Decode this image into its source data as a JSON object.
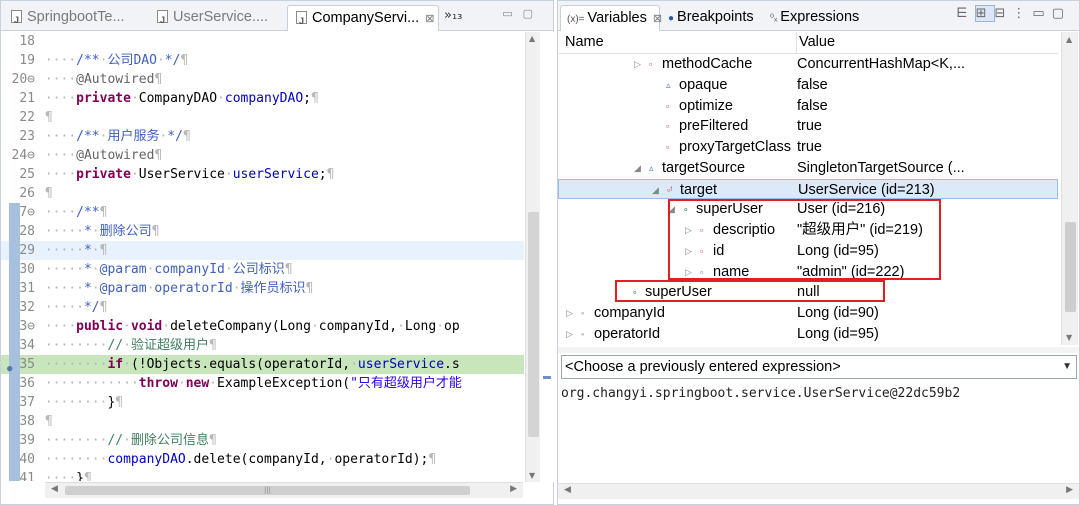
{
  "editor": {
    "tabs": [
      {
        "label": "SpringbootTe...",
        "active": false,
        "closable": false
      },
      {
        "label": "UserService....",
        "active": false,
        "closable": false
      },
      {
        "label": "CompanyServi...",
        "active": true,
        "closable": true
      }
    ],
    "tab_overflow": "»₁₃",
    "code_lines": [
      {
        "num": "18",
        "text": ""
      },
      {
        "num": "19",
        "text": "····/**·公司DAO·*/¶"
      },
      {
        "num": "20⊖",
        "text": "····@Autowired¶"
      },
      {
        "num": "21",
        "text": "····private·CompanyDAO·companyDAO;¶"
      },
      {
        "num": "22",
        "text": "¶"
      },
      {
        "num": "23",
        "text": "····/**·用户服务·*/¶"
      },
      {
        "num": "24⊖",
        "text": "····@Autowired¶"
      },
      {
        "num": "25",
        "text": "····private·UserService·userService;¶"
      },
      {
        "num": "26",
        "text": "¶"
      },
      {
        "num": "27⊖",
        "text": "····/**¶"
      },
      {
        "num": "28",
        "text": "·····*·删除公司¶"
      },
      {
        "num": "29",
        "text": "·····*·¶"
      },
      {
        "num": "30",
        "text": "·····*·@param·companyId·公司标识¶"
      },
      {
        "num": "31",
        "text": "·····*·@param·operatorId·操作员标识¶"
      },
      {
        "num": "32",
        "text": "·····*/¶"
      },
      {
        "num": "33⊖",
        "text": "····public·void·deleteCompany(Long·companyId,·Long·op"
      },
      {
        "num": "34",
        "text": "········//·验证超级用户¶"
      },
      {
        "num": "35",
        "text": "········if·(!Objects.equals(operatorId,·userService.s"
      },
      {
        "num": "36",
        "text": "············throw·new·ExampleException(\"只有超级用户才能"
      },
      {
        "num": "37",
        "text": "········}¶"
      },
      {
        "num": "38",
        "text": "¶"
      },
      {
        "num": "39",
        "text": "········//·删除公司信息¶"
      },
      {
        "num": "40",
        "text": "········companyDAO.delete(companyId,·operatorId);¶"
      },
      {
        "num": "41",
        "text": "····}¶"
      }
    ]
  },
  "variables_view": {
    "tabs": [
      {
        "label": "Variables",
        "icon": "variables-icon",
        "active": true
      },
      {
        "label": "Breakpoints",
        "icon": "breakpoints-icon",
        "active": false
      },
      {
        "label": "Expressions",
        "icon": "expressions-icon",
        "active": false
      }
    ],
    "tab_prefix": "(x)=",
    "columns": {
      "name": "Name",
      "value": "Value"
    },
    "rows": [
      {
        "name": "methodCache",
        "value": "ConcurrentHashMap<K,...",
        "twisty": "▷",
        "icon": "▫",
        "indent": 4
      },
      {
        "name": "opaque",
        "value": "false",
        "twisty": "",
        "icon": "▵",
        "indent": 5
      },
      {
        "name": "optimize",
        "value": "false",
        "twisty": "",
        "icon": "▫",
        "indent": 5
      },
      {
        "name": "preFiltered",
        "value": "true",
        "twisty": "",
        "icon": "▫",
        "indent": 5
      },
      {
        "name": "proxyTargetClass",
        "value": "true",
        "twisty": "",
        "icon": "▫",
        "indent": 5
      },
      {
        "name": "targetSource",
        "value": "SingletonTargetSource  (...",
        "twisty": "◢",
        "icon": "▵",
        "indent": 4
      },
      {
        "name": "target",
        "value": "UserService  (id=213)",
        "twisty": "◢",
        "icon": "▫ᶠ",
        "indent": 5,
        "selected": true
      },
      {
        "name": "superUser",
        "value": "User  (id=216)",
        "twisty": "◢",
        "icon": "∘",
        "indent": 6
      },
      {
        "name": "descriptio",
        "value": "\"超级用户\" (id=219)",
        "twisty": "▷",
        "icon": "▫",
        "indent": 7
      },
      {
        "name": "id",
        "value": "Long  (id=95)",
        "twisty": "▷",
        "icon": "▫",
        "indent": 7
      },
      {
        "name": "name",
        "value": "\"admin\" (id=222)",
        "twisty": "▷",
        "icon": "▫",
        "indent": 7
      },
      {
        "name": "superUser",
        "value": "null",
        "twisty": "",
        "icon": "∘",
        "indent": 3
      },
      {
        "name": "companyId",
        "value": "Long  (id=90)",
        "twisty": "▷",
        "icon": "◦",
        "indent": 0
      },
      {
        "name": "operatorId",
        "value": "Long  (id=95)",
        "twisty": "▷",
        "icon": "◦",
        "indent": 0
      }
    ],
    "expression_combo": "<Choose a previously entered expression>",
    "detail_text": "org.changyi.springboot.service.UserService@22dc59b2"
  }
}
